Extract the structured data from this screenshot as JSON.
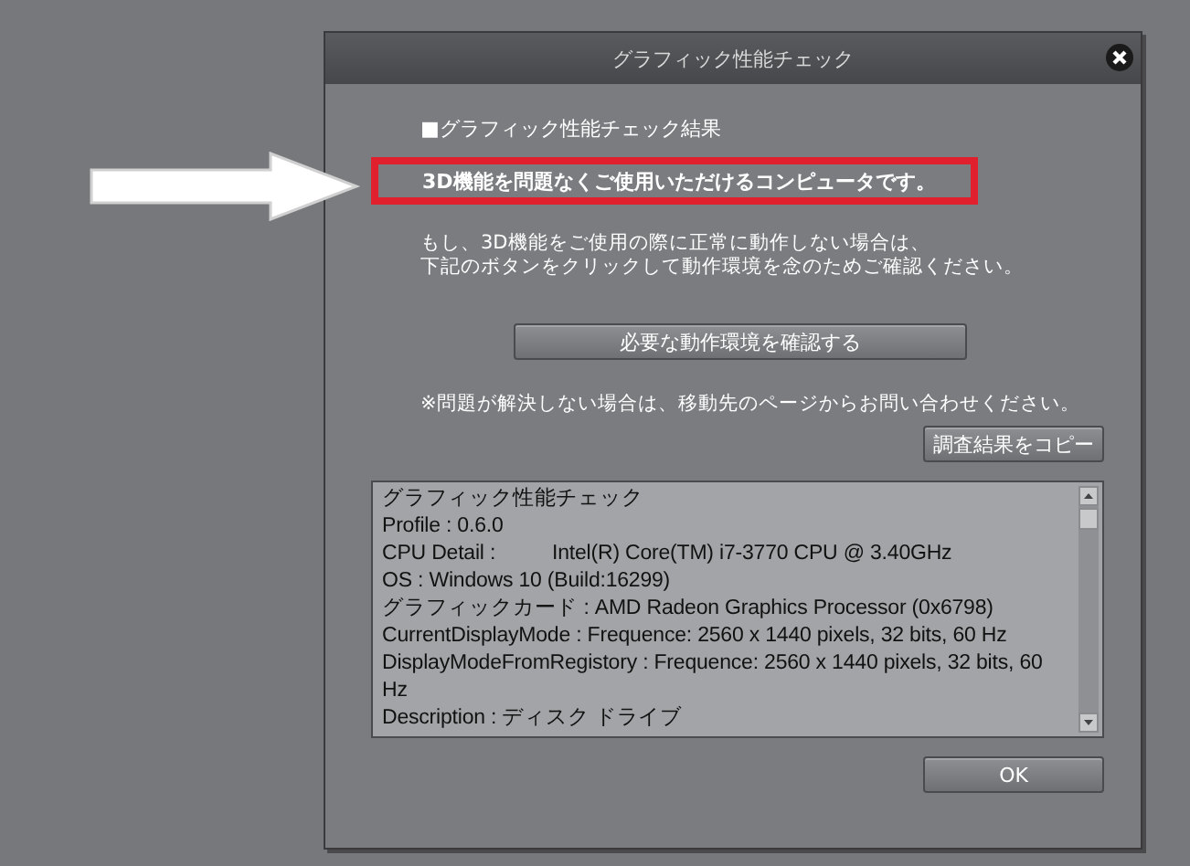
{
  "window": {
    "title": "グラフィック性能チェック"
  },
  "section_label": "■グラフィック性能チェック結果",
  "result_message": "3D機能を問題なくご使用いただけるコンピュータです。",
  "description": [
    "もし、3D機能をご使用の際に正常に動作しない場合は、",
    "下記のボタンをクリックして動作環境を念のためご確認ください。"
  ],
  "requirements_button": "必要な動作環境を確認する",
  "note": "※問題が解決しない場合は、移動先のページからお問い合わせください。",
  "copy_button": "調査結果をコピー",
  "log_lines": [
    "グラフィック性能チェック",
    "Profile : 0.6.0",
    "CPU Detail :          Intel(R) Core(TM) i7-3770 CPU @ 3.40GHz",
    "OS : Windows 10 (Build:16299)",
    "グラフィックカード : AMD Radeon Graphics Processor (0x6798)",
    "CurrentDisplayMode : Frequence: 2560 x 1440 pixels, 32 bits, 60 Hz",
    "DisplayModeFromRegistory : Frequence: 2560 x 1440 pixels, 32 bits, 60",
    "Hz",
    "Description : ディスク ドライブ"
  ],
  "ok_button": "OK"
}
